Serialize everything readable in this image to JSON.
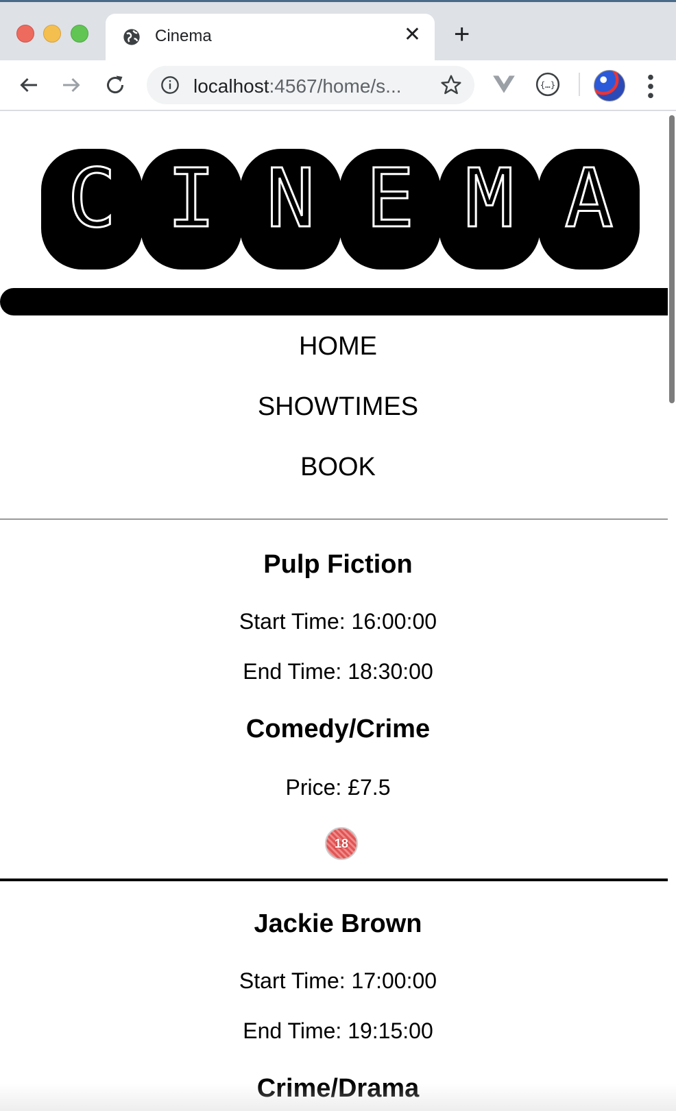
{
  "browser": {
    "tab_title": "Cinema",
    "url_host": "localhost",
    "url_rest": ":4567/home/s..."
  },
  "logo": {
    "letters": [
      "C",
      "I",
      "N",
      "E",
      "M",
      "A"
    ]
  },
  "nav": {
    "home": "HOME",
    "showtimes": "SHOWTIMES",
    "book": "BOOK"
  },
  "movies": [
    {
      "title": "Pulp Fiction",
      "start": "Start Time: 16:00:00",
      "end": "End Time: 18:30:00",
      "genre": "Comedy/Crime",
      "price": "Price: £7.5",
      "rating": "18"
    },
    {
      "title": "Jackie Brown",
      "start": "Start Time: 17:00:00",
      "end": "End Time: 19:15:00",
      "genre": "Crime/Drama"
    }
  ],
  "colors": {
    "rating_badge": "#e05555",
    "logo_bg": "#000000"
  }
}
